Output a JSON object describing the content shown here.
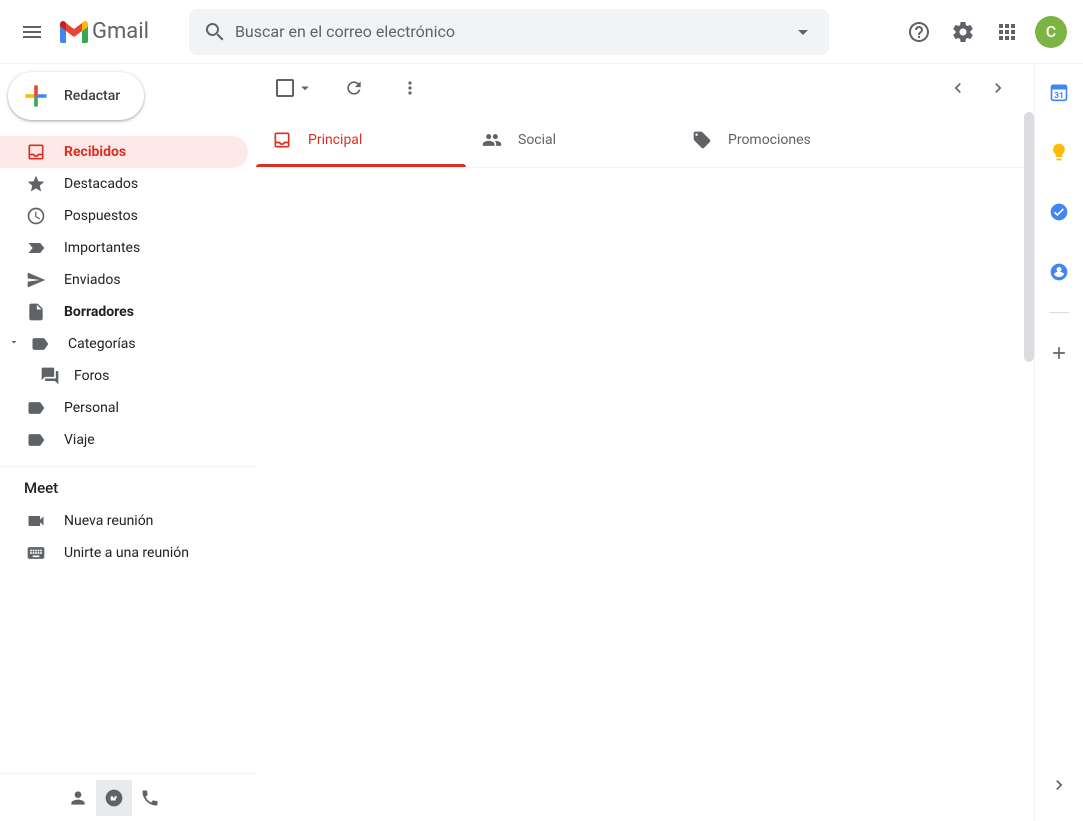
{
  "header": {
    "app_name": "Gmail",
    "search_placeholder": "Buscar en el correo electrónico",
    "avatar_letter": "C"
  },
  "compose": {
    "label": "Redactar"
  },
  "sidebar": {
    "items": [
      {
        "label": "Recibidos"
      },
      {
        "label": "Destacados"
      },
      {
        "label": "Pospuestos"
      },
      {
        "label": "Importantes"
      },
      {
        "label": "Enviados"
      },
      {
        "label": "Borradores"
      },
      {
        "label": "Categorías"
      },
      {
        "label": "Foros"
      },
      {
        "label": "Personal"
      },
      {
        "label": "Viaje"
      }
    ]
  },
  "meet": {
    "header": "Meet",
    "new": "Nueva reunión",
    "join": "Unirte a una reunión"
  },
  "tabs": {
    "primary": "Principal",
    "social": "Social",
    "promotions": "Promociones"
  }
}
